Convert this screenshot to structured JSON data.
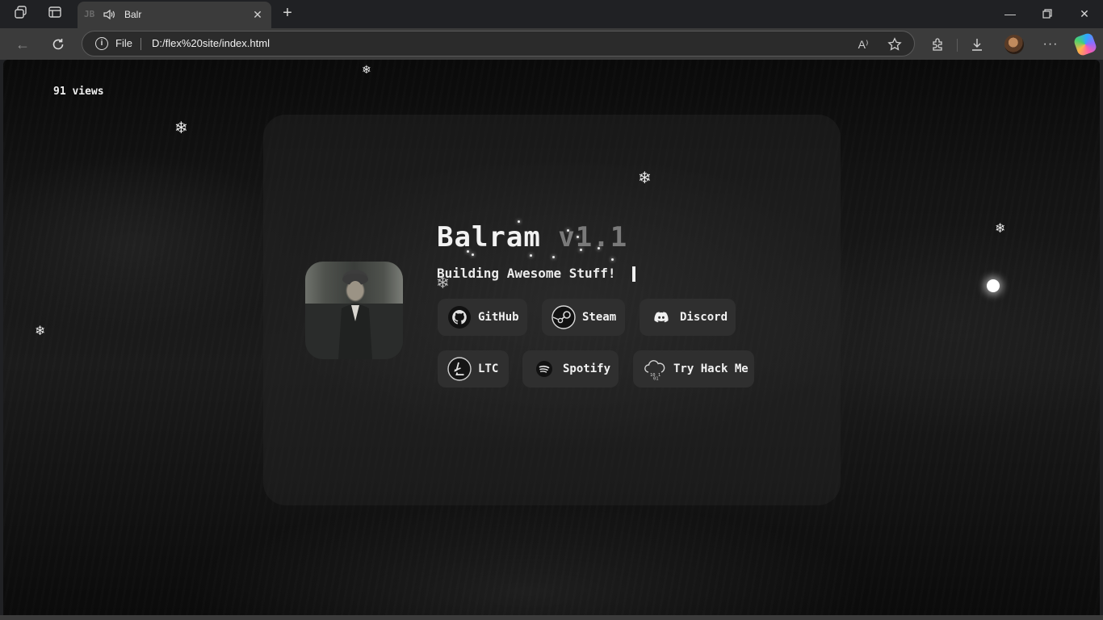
{
  "browser": {
    "tab_title": "Balr",
    "tab_favicon_text": "JB",
    "omnibox_scheme": "File",
    "url": "D:/flex%20site/index.html",
    "read_aloud_icon": "A⁾"
  },
  "page": {
    "views": "91 views",
    "title_name": "Balram ",
    "title_version": "v1.1",
    "subtitle": "Building Awesome Stuff!",
    "buttons": [
      {
        "label": "GitHub",
        "icon": "github-icon"
      },
      {
        "label": "Steam",
        "icon": "steam-icon"
      },
      {
        "label": "Discord",
        "icon": "discord-icon"
      },
      {
        "label": "LTC",
        "icon": "litecoin-icon"
      },
      {
        "label": "Spotify",
        "icon": "spotify-icon"
      },
      {
        "label": "Try Hack Me",
        "icon": "tryhackme-icon"
      }
    ]
  },
  "colors": {
    "browser_bg": "#202124",
    "toolbar_bg": "#3b3b3b",
    "card_bg": "#262626",
    "button_bg": "#2f2f2f",
    "text": "#f2f2f2",
    "version_text": "#7a7a7a"
  }
}
